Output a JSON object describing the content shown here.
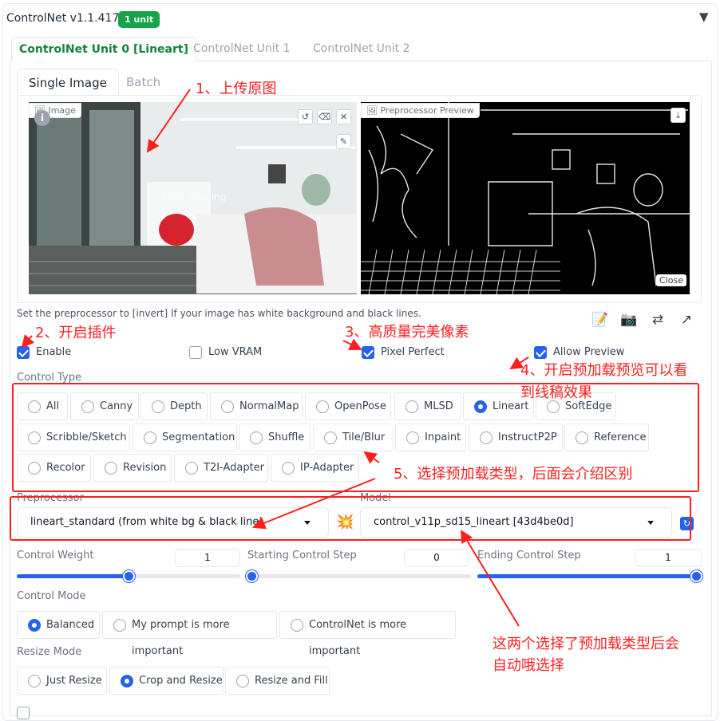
{
  "header": {
    "title": "ControlNet v1.1.417",
    "badge": "1 unit",
    "collapse_icon": "triangle-down"
  },
  "unit_tabs": [
    {
      "label": "ControlNet Unit 0 [Lineart]",
      "active": true
    },
    {
      "label": "ControlNet Unit 1",
      "active": false
    },
    {
      "label": "ControlNet Unit 2",
      "active": false
    }
  ],
  "image_tabs": [
    {
      "label": "Single Image",
      "active": true
    },
    {
      "label": "Batch",
      "active": false
    }
  ],
  "image_panel": {
    "label": "Image",
    "overlay_text": "Start drawing"
  },
  "preview_panel": {
    "label": "Preprocessor Preview",
    "close_label": "Close"
  },
  "hint": "Set the preprocessor to [invert] If your image has white background and black lines.",
  "toolbar_icons": [
    "edit-icon",
    "camera-icon",
    "swap-icon",
    "send-icon"
  ],
  "checkboxes": {
    "enable": {
      "label": "Enable",
      "checked": true
    },
    "low_vram": {
      "label": "Low VRAM",
      "checked": false
    },
    "pixel_perfect": {
      "label": "Pixel Perfect",
      "checked": true
    },
    "allow_preview": {
      "label": "Allow Preview",
      "checked": true
    }
  },
  "control_type": {
    "label": "Control Type",
    "options": [
      "All",
      "Canny",
      "Depth",
      "NormalMap",
      "OpenPose",
      "MLSD",
      "Lineart",
      "SoftEdge",
      "Scribble/Sketch",
      "Segmentation",
      "Shuffle",
      "Tile/Blur",
      "Inpaint",
      "InstructP2P",
      "Reference",
      "Recolor",
      "Revision",
      "T2I-Adapter",
      "IP-Adapter"
    ],
    "selected": "Lineart"
  },
  "preprocessor": {
    "label": "Preprocessor",
    "value": "lineart_standard (from white bg & black line)"
  },
  "model": {
    "label": "Model",
    "value": "control_v11p_sd15_lineart [43d4be0d]"
  },
  "sliders": {
    "weight": {
      "label": "Control Weight",
      "value": "1",
      "fraction": 0.5
    },
    "start": {
      "label": "Starting Control Step",
      "value": "0",
      "fraction": 0.0
    },
    "end": {
      "label": "Ending Control Step",
      "value": "1",
      "fraction": 1.0
    }
  },
  "control_mode": {
    "label": "Control Mode",
    "options": [
      "Balanced",
      "My prompt is more important",
      "ControlNet is more important"
    ],
    "selected": "Balanced"
  },
  "resize_mode": {
    "label": "Resize Mode",
    "options": [
      "Just Resize",
      "Crop and Resize",
      "Resize and Fill"
    ],
    "selected": "Crop and Resize"
  },
  "annotations": {
    "a1": "1、上传原图",
    "a2": "2、开启插件",
    "a3": "3、高质量完美像素",
    "a4_line1": "4、开启预加载预览可以看",
    "a4_line2": "到线稿效果",
    "a5": "5、选择预加载类型，后面会介绍区别",
    "a6_line1": "这两个选择了预加载类型后会",
    "a6_line2": "自动哦选择"
  },
  "colors": {
    "accent": "#2563eb",
    "badge": "#16a34a",
    "annotation": "#ff1f1f",
    "active_tab": "#15803d"
  }
}
